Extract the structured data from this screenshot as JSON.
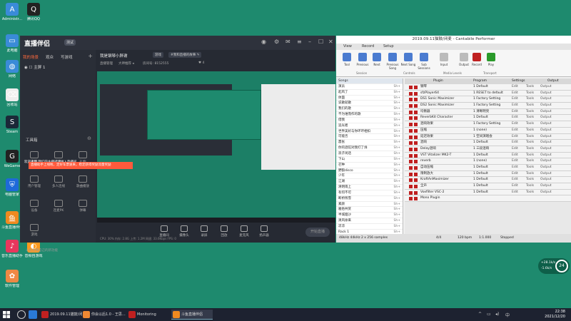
{
  "desktop": {
    "icons": [
      {
        "label": "Administr...",
        "color": "#3a8bd8",
        "glyph": "A"
      },
      {
        "label": "腾讯QQ",
        "color": "#222",
        "glyph": "Q"
      },
      {
        "label": "此电脑",
        "color": "#3a8bd8",
        "glyph": "▭"
      },
      {
        "label": "网络",
        "color": "#3a8bd8",
        "glyph": "◍"
      },
      {
        "label": "回收站",
        "color": "#eee",
        "glyph": "⌫"
      },
      {
        "label": "Steam",
        "color": "#1b2838",
        "glyph": "S"
      },
      {
        "label": "WeGame",
        "color": "#222",
        "glyph": "G"
      },
      {
        "label": "电脑管家",
        "color": "#1e6ad8",
        "glyph": "⛨"
      },
      {
        "label": "斗鱼直播伴侣",
        "color": "#f08a20",
        "glyph": "鱼"
      },
      {
        "label": "音乐直播助手",
        "color": "#e8365d",
        "glyph": "♪"
      },
      {
        "label": "音频自游戏",
        "color": "#ff9a20",
        "glyph": "◐"
      },
      {
        "label": "软件管理",
        "color": "#e84",
        "glyph": "✿"
      }
    ]
  },
  "live_app": {
    "logo": "直播伴侣",
    "version": "测试",
    "title": "我是钢琴小胖谢 ",
    "chip1": "游戏",
    "chip2": "#我和直播的故事  ✎",
    "meta1": "直播管理",
    "meta2": "大神推荐 ◂",
    "meta3": "房间号: 8152555",
    "meta4": "♥ 4",
    "tabs": [
      "我的场景",
      "观众",
      "写游戏"
    ],
    "scene": "◉  ☐  主屏 1",
    "tool_title": "工具箱",
    "tools": [
      {
        "label": "电脑"
      },
      {
        "label": "互动"
      },
      {
        "label": "礼物"
      },
      {
        "label": "用户管理"
      },
      {
        "label": "多人连线"
      },
      {
        "label": "歌曲播放"
      },
      {
        "label": "设备"
      },
      {
        "label": "连麦PK"
      },
      {
        "label": "弹幕"
      },
      {
        "label": "游戏"
      }
    ],
    "notice": "欢迎来到 我们的主播间请进入直播间",
    "orange_banner": "直播助手上线啦，定好车票速来，稳定获得奖励流量奖励",
    "stream_note": "斗鱼直播自己的新功能",
    "controls": [
      "直播间",
      "摄像头",
      "录屏",
      "回放",
      "麦克风",
      "扬声器"
    ],
    "start_label": "开始直播",
    "status": "CPU: 30% 内存: 2.8G 上传: 1.2M  网速: 33.6Kbps  FPS: 0"
  },
  "cantabile": {
    "title": "2019.09.11猫鼓/闭麦 - Cantabile Performer",
    "tabs": [
      "View",
      "Record",
      "Setup"
    ],
    "ribbon_buttons": [
      {
        "label": "Tool",
        "color": "#4a7bd0"
      },
      {
        "label": "Previous",
        "color": "#4a7bd0"
      },
      {
        "label": "Next",
        "color": "#4a7bd0"
      },
      {
        "label": "Previous Song",
        "color": "#4a7bd0"
      },
      {
        "label": "Next Song",
        "color": "#4a7bd0"
      },
      {
        "label": "Sub Sessions",
        "color": "#4a7bd0"
      },
      {
        "label": "Input",
        "color": "#bbb"
      },
      {
        "label": "Output",
        "color": "#bbb"
      },
      {
        "label": "Record",
        "color": "#c02020"
      },
      {
        "label": "Play",
        "color": "#2a9a2a"
      }
    ],
    "ribbon_groups": [
      "Session",
      "Controls",
      "Media Levels",
      "Transport"
    ],
    "songs_header": "Songs",
    "songs": [
      {
        "name": "演员",
        "key": "Sh+"
      },
      {
        "name": "起风了",
        "key": "Sh+"
      },
      {
        "name": "体面",
        "key": "Sh+"
      },
      {
        "name": "说散就散",
        "key": "Sh+"
      },
      {
        "name": "我们的歌",
        "key": "Sh+"
      },
      {
        "name": "不为谁而作的歌",
        "key": "Sh+"
      },
      {
        "name": "借我",
        "key": "Sh+"
      },
      {
        "name": "追光者",
        "key": "Sh+"
      },
      {
        "name": "世界美好与你环环相扣",
        "key": "Sh+"
      },
      {
        "name": "可能否",
        "key": "Sh+"
      },
      {
        "name": "嚣张",
        "key": "Sh+"
      },
      {
        "name": "你的酒馆对我打了烊",
        "key": "Sh+"
      },
      {
        "name": "浪子闲话",
        "key": "Sh+"
      },
      {
        "name": "下山",
        "key": "Sh+"
      },
      {
        "name": "芒种",
        "key": "Sh+"
      },
      {
        "name": "野狼disco",
        "key": "Sh+"
      },
      {
        "name": "少年",
        "key": "Sh+"
      },
      {
        "name": "江湖",
        "key": "Sh+"
      },
      {
        "name": "清明雨上",
        "key": "Sh+"
      },
      {
        "name": "有何不可",
        "key": "Sh+"
      },
      {
        "name": "断桥残雪",
        "key": "Sh+"
      },
      {
        "name": "素颜",
        "key": "Sh+"
      },
      {
        "name": "雅俗共赏",
        "key": "Sh+"
      },
      {
        "name": "半城烟沙",
        "key": "Sh+"
      },
      {
        "name": "清风徐来",
        "key": "Sh+"
      },
      {
        "name": "凉凉",
        "key": "Sh+"
      },
      {
        "name": "Rack 1",
        "key": "Sh+"
      }
    ],
    "rack_header": {
      "plugin": "Plugin",
      "program": "Program",
      "settings": "Settings",
      "output": "Output"
    },
    "racks": [
      {
        "plugin": "钢琴",
        "program": "1 Default"
      },
      {
        "plugin": "sfzPlayer64",
        "program": "1 RESET to default"
      },
      {
        "plugin": "DS1 Sonic Maximizer",
        "program": "1 Factory Setting"
      },
      {
        "plugin": "DS2 Sonic Maximizer",
        "program": "1 Factory Setting"
      },
      {
        "plugin": "均衡器",
        "program": "1 清晰明亮"
      },
      {
        "plugin": "ReverbKit Character",
        "program": "1 Default"
      },
      {
        "plugin": "混响效果",
        "program": "1 Factory Setting"
      },
      {
        "plugin": "压缩",
        "program": "1 (none)"
      },
      {
        "plugin": "延迟效果",
        "program": "1 空间演唱会"
      },
      {
        "plugin": "混响",
        "program": "1 Default"
      },
      {
        "plugin": "Delay混响",
        "program": "1 三段混响"
      },
      {
        "plugin": "VST Vitalizer MK2-T",
        "program": "1 Default"
      },
      {
        "plugin": "reverb",
        "program": "1 (none)"
      },
      {
        "plugin": "自动压缩",
        "program": "1 Default"
      },
      {
        "plugin": "限制放大",
        "program": "1 Default"
      },
      {
        "plugin": "KraftAnMaximizer",
        "program": "1 Default"
      },
      {
        "plugin": "全声",
        "program": "1 Default"
      },
      {
        "plugin": "Voxfilter VSC-2",
        "program": "1 Default"
      },
      {
        "plugin": "Mono Plugin",
        "program": ""
      }
    ],
    "status": [
      "48kHz 44kHz 2 x 256 samples",
      "4/4",
      "120 bpm",
      "1:1.000",
      "Stopped"
    ]
  },
  "perf_widget": {
    "value": "24",
    "line1": "+28.1k/s",
    "line2": "-1.6k/s"
  },
  "taskbar": {
    "items": [
      {
        "label": "2019.09.11猫鼓/闭...",
        "color": "#c02020"
      },
      {
        "label": "你会以后1.0 - 王思...",
        "color": "#e83"
      },
      {
        "label": "Monitoring",
        "color": "#c02020"
      },
      {
        "label": "斗鱼直播伴侣",
        "color": "#f08a20"
      }
    ],
    "time": "22:38",
    "date": "2021/12/20"
  }
}
